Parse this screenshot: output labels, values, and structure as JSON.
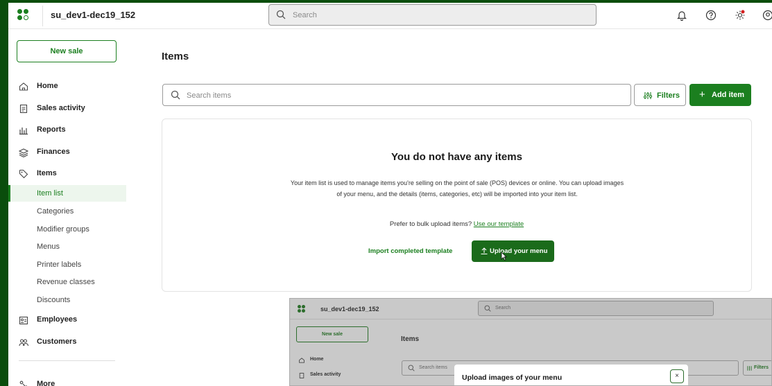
{
  "app": {
    "name": "su_dev1-dec19_152",
    "search_placeholder": "Search"
  },
  "sidebar": {
    "new_sale": "New sale",
    "nav": [
      {
        "label": "Home",
        "icon": "home-icon"
      },
      {
        "label": "Sales activity",
        "icon": "receipt-icon"
      },
      {
        "label": "Reports",
        "icon": "bar-chart-icon"
      },
      {
        "label": "Finances",
        "icon": "layers-icon"
      },
      {
        "label": "Items",
        "icon": "tag-icon"
      }
    ],
    "items_sub": [
      "Item list",
      "Categories",
      "Modifier groups",
      "Menus",
      "Printer labels",
      "Revenue classes",
      "Discounts"
    ],
    "nav2": [
      {
        "label": "Employees",
        "icon": "id-card-icon"
      },
      {
        "label": "Customers",
        "icon": "people-icon"
      }
    ],
    "more": "More"
  },
  "main": {
    "title": "Items",
    "search_placeholder": "Search items",
    "filters": "Filters",
    "add_item": "Add item",
    "empty": {
      "heading": "You do not have any items",
      "body": "Your item list is used to manage items you're selling on the point of sale (POS) devices or online. You can upload images of your menu, and the details (items, categories, etc) will be imported into your item list.",
      "bulk_prompt": "Prefer to bulk upload items?",
      "bulk_link": "Use our template",
      "import_label": "Import completed template",
      "upload_label": "Upload your menu"
    }
  },
  "overlay": {
    "app_name": "su_dev1-dec19_152",
    "search_placeholder": "Search",
    "new_sale": "New sale",
    "title": "Items",
    "nav": [
      "Home",
      "Sales activity"
    ],
    "items_search_placeholder": "Search items",
    "filters": "Filters",
    "modal_title": "Upload images of your menu",
    "modal_close": "×"
  },
  "colors": {
    "brand": "#1b7f1f",
    "frame": "#0a4d0c"
  }
}
